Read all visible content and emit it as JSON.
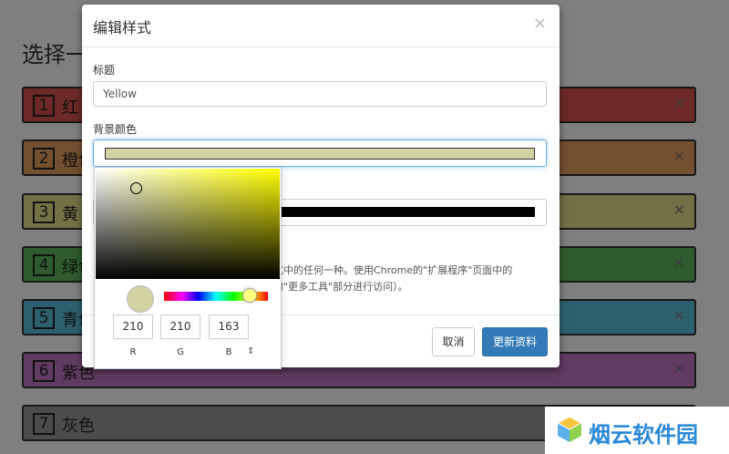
{
  "page": {
    "title": "选择一",
    "rows": [
      {
        "num": "1",
        "label": "红",
        "color": "#d9534f",
        "close": "×"
      },
      {
        "num": "2",
        "label": "橙色",
        "color": "#e8a060",
        "close": "×"
      },
      {
        "num": "3",
        "label": "黄",
        "color": "#e6e08a",
        "close": "×"
      },
      {
        "num": "4",
        "label": "绿色",
        "color": "#5cb85c",
        "close": "×"
      },
      {
        "num": "5",
        "label": "青色",
        "color": "#5bc0de",
        "close": "×"
      },
      {
        "num": "6",
        "label": "紫色",
        "color": "#c277c2",
        "close": "×"
      },
      {
        "num": "7",
        "label": "灰色",
        "color": "#999999",
        "close": "×"
      }
    ]
  },
  "modal": {
    "title": "编辑样式",
    "close": "×",
    "title_field": {
      "label": "标题",
      "value": "Yellow"
    },
    "bg_field": {
      "label": "背景颜色",
      "color": "#d2d2a3"
    },
    "fg_field": {
      "color": "#000000"
    },
    "help_lines": [
      "式中的任何一种。使用Chrome的\"扩展程序\"页面中的",
      "的\"更多工具\"部分进行访问）。"
    ],
    "cancel_label": "取消",
    "save_label": "更新资料"
  },
  "picker": {
    "preview_color": "#d2d2a3",
    "r": "210",
    "g": "210",
    "b": "163",
    "r_label": "R",
    "g_label": "G",
    "b_label": "B",
    "mode_toggle": "⇕"
  },
  "watermark": {
    "text": "烟云软件园"
  }
}
